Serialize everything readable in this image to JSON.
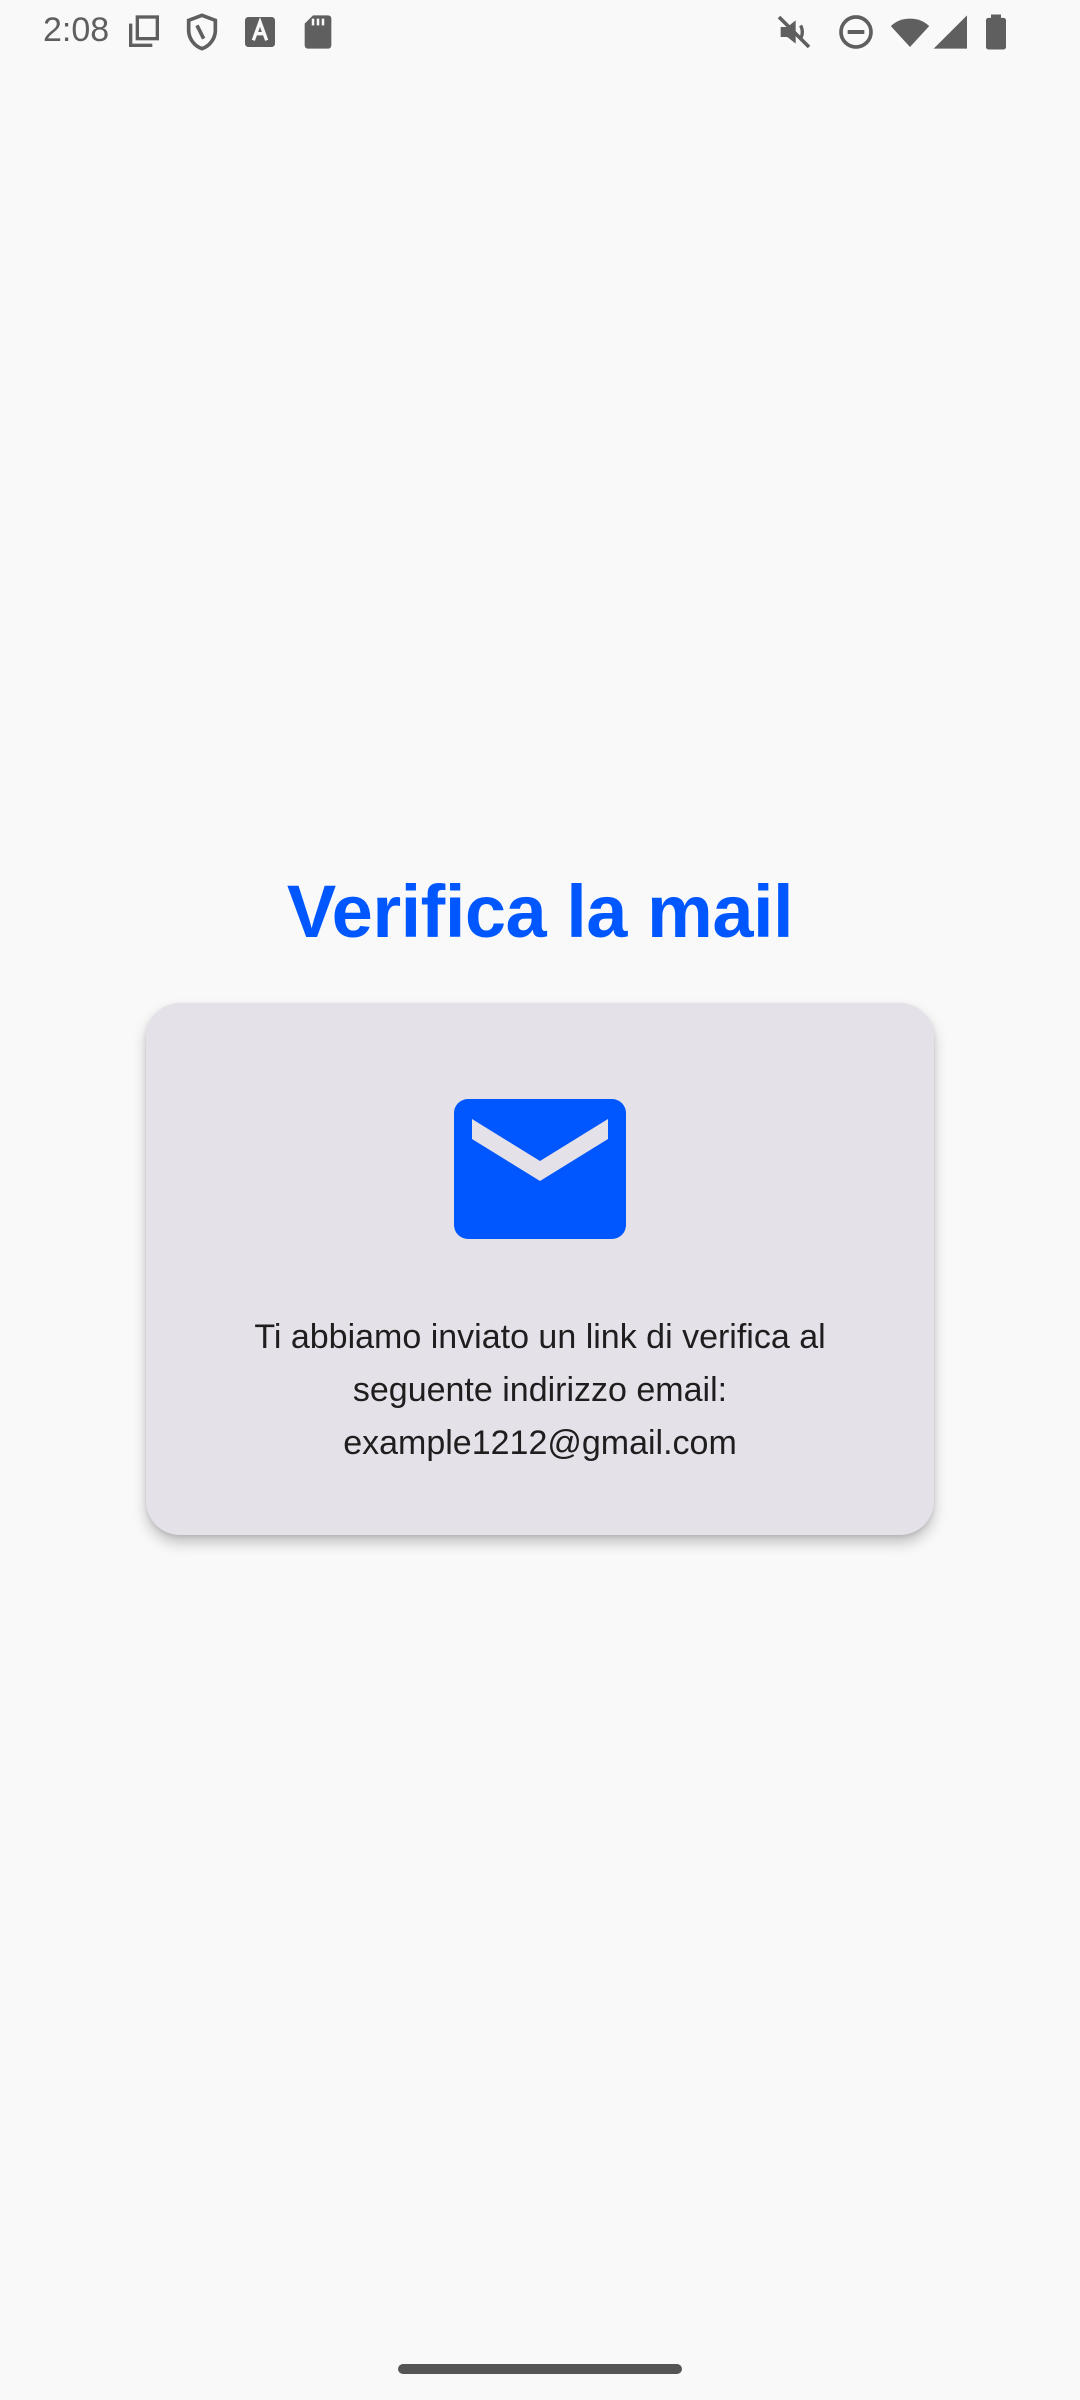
{
  "status_bar": {
    "time": "2:08",
    "left_icons": [
      "screenshot-icon",
      "vpn-shield-icon",
      "font-a-icon",
      "sd-card-icon"
    ],
    "right_icons": [
      "vibrate-mute-icon",
      "do-not-disturb-icon",
      "wifi-icon",
      "cellular-signal-icon",
      "battery-icon"
    ]
  },
  "page": {
    "title": "Verifica la mail"
  },
  "card": {
    "icon": "mail-icon",
    "message_line_1": "Ti abbiamo inviato un link di verifica al",
    "message_line_2": "seguente indirizzo email:",
    "email": "example1212@gmail.com"
  },
  "colors": {
    "accent": "#0057ff",
    "background": "#f9f9f9",
    "card_background": "#e5e1e8",
    "text": "#1e1e1e",
    "status_icon": "#5f5f5f"
  }
}
